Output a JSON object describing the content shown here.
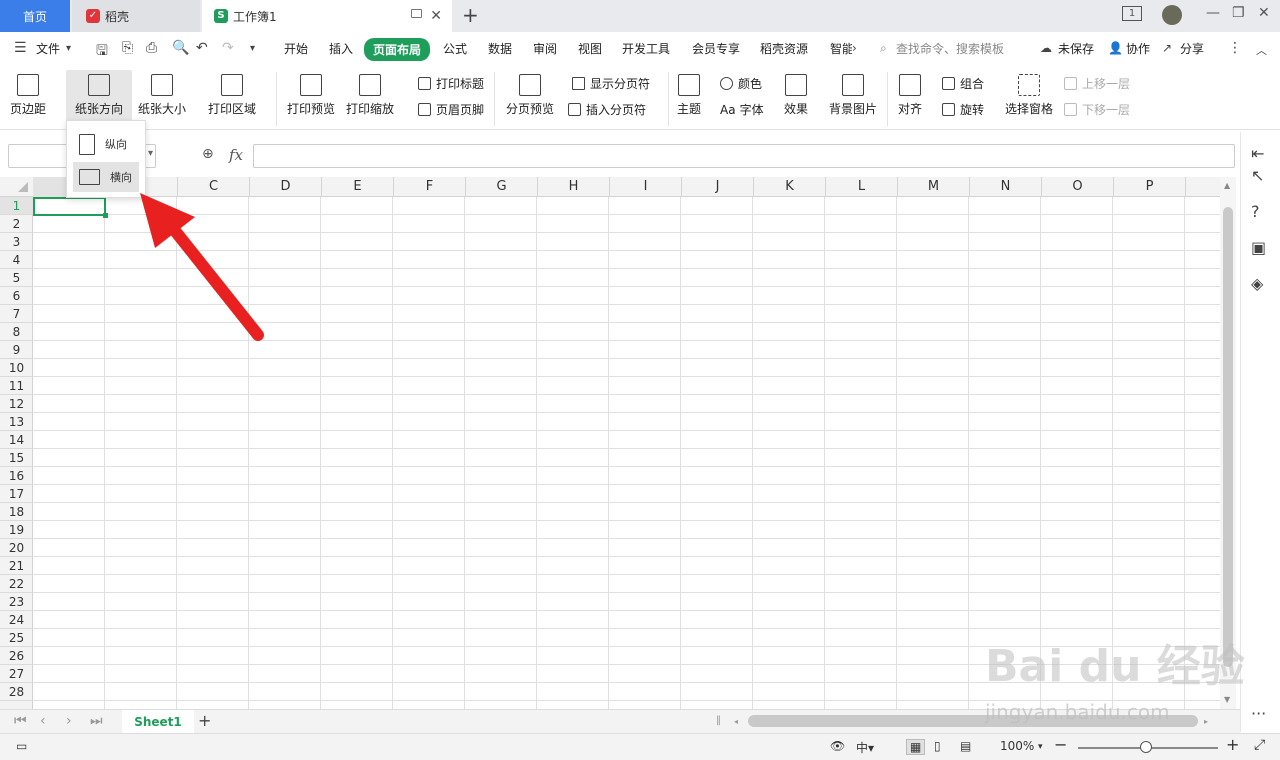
{
  "tabs": {
    "home": "首页",
    "daoke": "稻壳",
    "doc": "工作簿1",
    "add": "+"
  },
  "window": {
    "badge": "1"
  },
  "menu": {
    "file": "文件",
    "items": [
      "开始",
      "插入",
      "页面布局",
      "公式",
      "数据",
      "审阅",
      "视图",
      "开发工具",
      "会员专享",
      "稻壳资源",
      "智能"
    ],
    "active": "页面布局",
    "search": "查找命令、搜索模板",
    "unsaved": "未保存",
    "collab": "协作",
    "share": "分享"
  },
  "ribbon": {
    "margins": "页边距",
    "orientation": "纸张方向",
    "size": "纸张大小",
    "print_area": "打印区域",
    "print_preview": "打印预览",
    "print_scale": "打印缩放",
    "print_titles": "打印标题",
    "header_footer": "页眉页脚",
    "page_break_preview": "分页预览",
    "show_page_breaks": "显示分页符",
    "insert_page_break": "插入分页符",
    "theme": "主题",
    "colors": "颜色",
    "fonts": "字体",
    "effects": "效果",
    "bg_image": "背景图片",
    "align": "对齐",
    "group": "组合",
    "rotate": "旋转",
    "selection_pane": "选择窗格",
    "bring_forward": "上移一层",
    "send_backward": "下移一层"
  },
  "dropdown": {
    "portrait": "纵向",
    "landscape": "横向"
  },
  "formula": {
    "fx": "fx"
  },
  "columns": [
    "C",
    "D",
    "E",
    "F",
    "G",
    "H",
    "I",
    "J",
    "K",
    "L",
    "M",
    "N",
    "O",
    "P"
  ],
  "rows": [
    "1",
    "2",
    "3",
    "4",
    "5",
    "6",
    "7",
    "8",
    "9",
    "10",
    "11",
    "12",
    "13",
    "14",
    "15",
    "16",
    "17",
    "18",
    "19",
    "20",
    "21",
    "22",
    "23",
    "24",
    "25",
    "26",
    "27",
    "28"
  ],
  "sheet": {
    "name": "Sheet1"
  },
  "status": {
    "zoom": "100%"
  },
  "watermark": {
    "line1": "Bai du 经验",
    "line2": "jingyan.baidu.com"
  },
  "colors": {
    "accent": "#1e9e5a",
    "home_tab": "#3b7de9",
    "arrow": "#e82020"
  }
}
